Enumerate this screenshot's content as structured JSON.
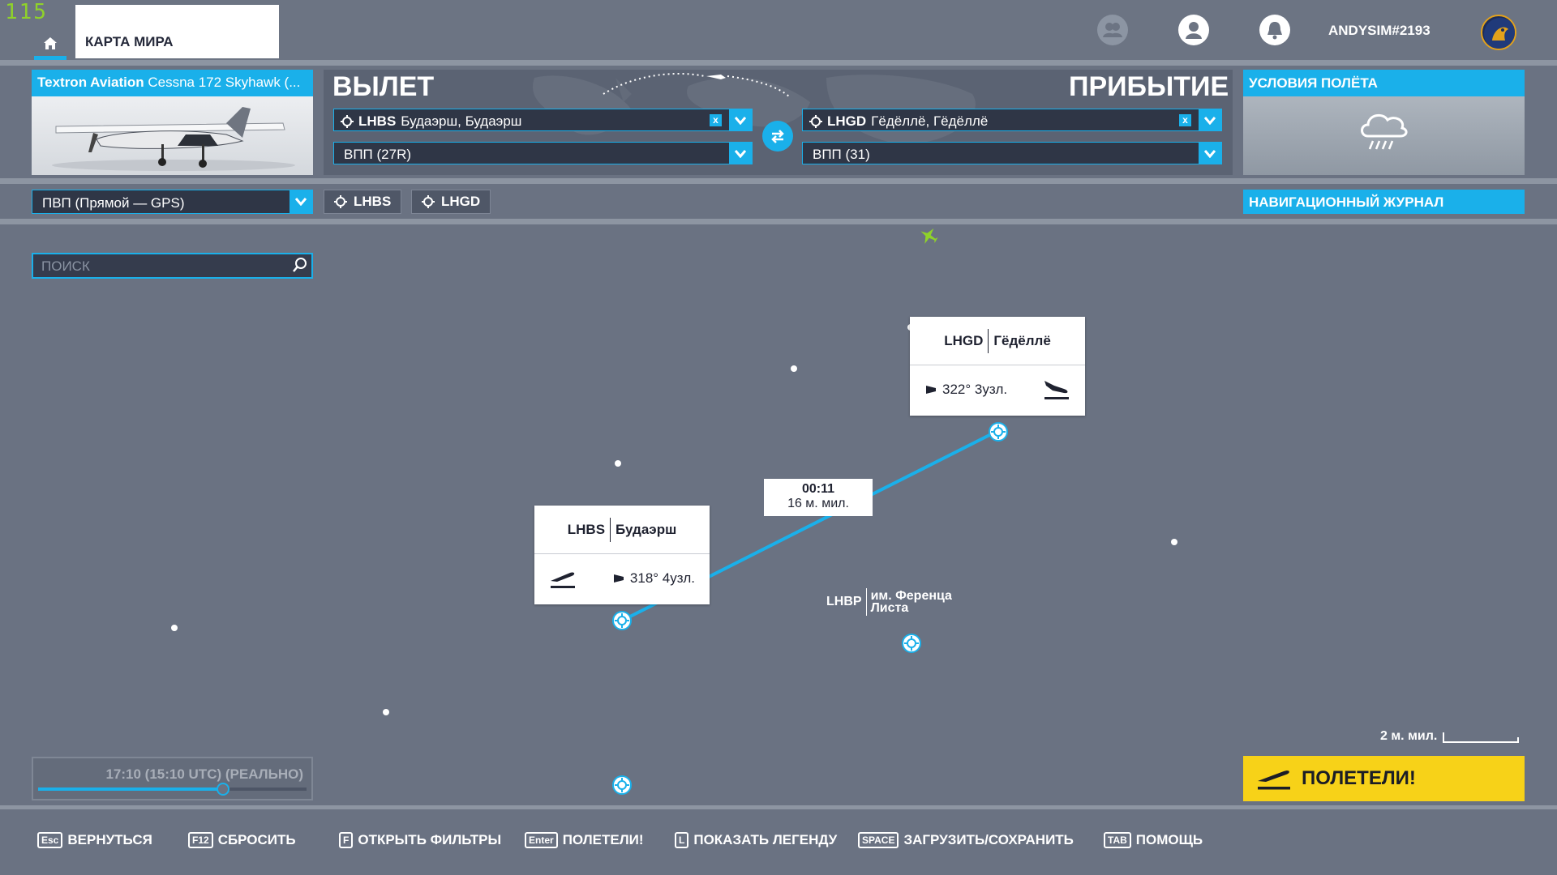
{
  "fps": "115",
  "nav": {
    "world_map": "КАРТА МИРА",
    "username": "ANDYSIM#2193"
  },
  "aircraft": {
    "brand": "Textron Aviation",
    "model": "Cessna 172 Skyhawk (..."
  },
  "departure": {
    "title": "ВЫЛЕТ",
    "airport": "LHBS",
    "airport_name": "Будаэрш, Будаэрш",
    "runway": "ВПП (27R)"
  },
  "arrival": {
    "title": "ПРИБЫТИЕ",
    "airport": "LHGD",
    "airport_name": "Гёдёллё, Гёдёллё",
    "runway": "ВПП (31)"
  },
  "weather": {
    "title": "УСЛОВИЯ ПОЛЁТА"
  },
  "flight_type": "ПВП (Прямой — GPS)",
  "waypoints": [
    "LHBS",
    "LHGD"
  ],
  "navlog": "НАВИГАЦИОННЫЙ ЖУРНАЛ",
  "search": {
    "placeholder": "ПОИСК"
  },
  "map": {
    "dep_card": {
      "code": "LHBS",
      "name": "Будаэрш",
      "wind": "318° 4узл."
    },
    "arr_card": {
      "code": "LHGD",
      "name": "Гёдёллё",
      "wind": "322° 3узл."
    },
    "leg": {
      "time": "00:11",
      "distance": "16 м. мил."
    },
    "airport_label": {
      "code": "LHBP",
      "name_line1": "им. Ференца",
      "name_line2": "Листа"
    },
    "scale": "2 м. мил."
  },
  "time": {
    "value": "17:10 (15:10 UTC) (РЕАЛЬНО)",
    "slider_fraction": 0.69
  },
  "go_button": "ПОЛЕТЕЛИ!",
  "hotkeys": [
    {
      "key": "Esc",
      "label": "ВЕРНУТЬСЯ"
    },
    {
      "key": "F12",
      "label": "СБРОСИТЬ"
    },
    {
      "key": "F",
      "label": "ОТКРЫТЬ ФИЛЬТРЫ"
    },
    {
      "key": "Enter",
      "label": "ПОЛЕТЕЛИ!"
    },
    {
      "key": "L",
      "label": "ПОКАЗАТЬ ЛЕГЕНДУ"
    },
    {
      "key": "SPACE",
      "label": "ЗАГРУЗИТЬ/СОХРАНИТЬ"
    },
    {
      "key": "TAB",
      "label": "ПОМОЩЬ"
    }
  ],
  "colors": {
    "accent": "#1ab0ea",
    "go": "#f7d218",
    "map_bg": "#6a7282"
  }
}
